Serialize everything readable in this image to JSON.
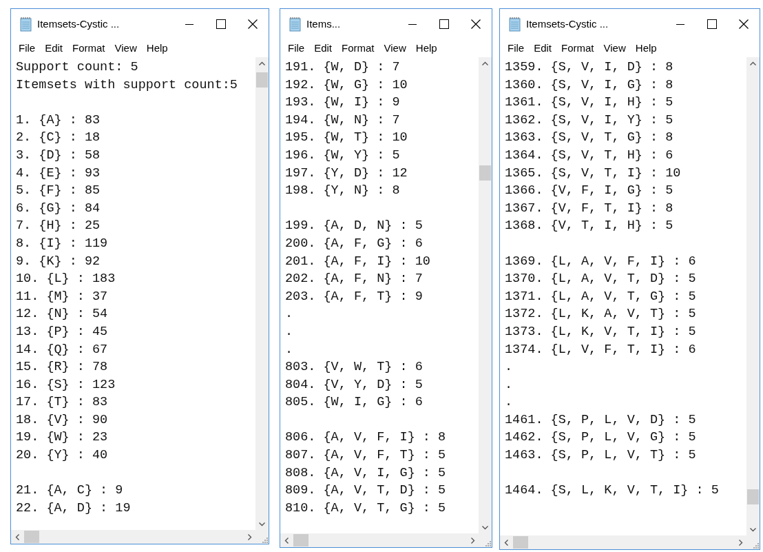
{
  "windows": [
    {
      "title": "Itemsets-Cystic ...",
      "menu": [
        "File",
        "Edit",
        "Format",
        "View",
        "Help"
      ],
      "blocks": [
        [
          "Support count: 5",
          "Itemsets with support count:5"
        ],
        [
          "1. {A} : 83",
          "2. {C} : 18",
          "3. {D} : 58",
          "4. {E} : 93",
          "5. {F} : 85",
          "6. {G} : 84",
          "7. {H} : 25",
          "8. {I} : 119",
          "9. {K} : 92",
          "10. {L} : 183",
          "11. {M} : 37",
          "12. {N} : 54",
          "13. {P} : 45",
          "14. {Q} : 67",
          "15. {R} : 78",
          "16. {S} : 123",
          "17. {T} : 83",
          "18. {V} : 90",
          "19. {W} : 23",
          "20. {Y} : 40"
        ],
        [
          "21. {A, C} : 9",
          "22. {A, D} : 19"
        ]
      ]
    },
    {
      "title": "Items...",
      "menu": [
        "File",
        "Edit",
        "Format",
        "View",
        "Help"
      ],
      "blocks": [
        [
          "191. {W, D} : 7",
          "192. {W, G} : 10",
          "193. {W, I} : 9",
          "194. {W, N} : 7",
          "195. {W, T} : 10",
          "196. {W, Y} : 5",
          "197. {Y, D} : 12",
          "198. {Y, N} : 8"
        ],
        [
          "199. {A, D, N} : 5",
          "200. {A, F, G} : 6",
          "201. {A, F, I} : 10",
          "202. {A, F, N} : 7",
          "203. {A, F, T} : 9",
          ".",
          ".",
          ".",
          "803. {V, W, T} : 6",
          "804. {V, Y, D} : 5",
          "805. {W, I, G} : 6"
        ],
        [
          "806. {A, V, F, I} : 8",
          "807. {A, V, F, T} : 5",
          "808. {A, V, I, G} : 5",
          "809. {A, V, T, D} : 5",
          "810. {A, V, T, G} : 5"
        ]
      ]
    },
    {
      "title": "Itemsets-Cystic ...",
      "menu": [
        "File",
        "Edit",
        "Format",
        "View",
        "Help"
      ],
      "blocks": [
        [
          "1359. {S, V, I, D} : 8",
          "1360. {S, V, I, G} : 8",
          "1361. {S, V, I, H} : 5",
          "1362. {S, V, I, Y} : 5",
          "1363. {S, V, T, G} : 8",
          "1364. {S, V, T, H} : 6",
          "1365. {S, V, T, I} : 10",
          "1366. {V, F, I, G} : 5",
          "1367. {V, F, T, I} : 8",
          "1368. {V, T, I, H} : 5"
        ],
        [
          "1369. {L, A, V, F, I} : 6",
          "1370. {L, A, V, T, D} : 5",
          "1371. {L, A, V, T, G} : 5",
          "1372. {L, K, A, V, T} : 5",
          "1373. {L, K, V, T, I} : 5",
          "1374. {L, V, F, T, I} : 6",
          ".",
          ".",
          ".",
          "1461. {S, P, L, V, D} : 5",
          "1462. {S, P, L, V, G} : 5",
          "1463. {S, P, L, V, T} : 5"
        ],
        [
          "1464. {S, L, K, V, T, I} : 5"
        ]
      ]
    }
  ]
}
